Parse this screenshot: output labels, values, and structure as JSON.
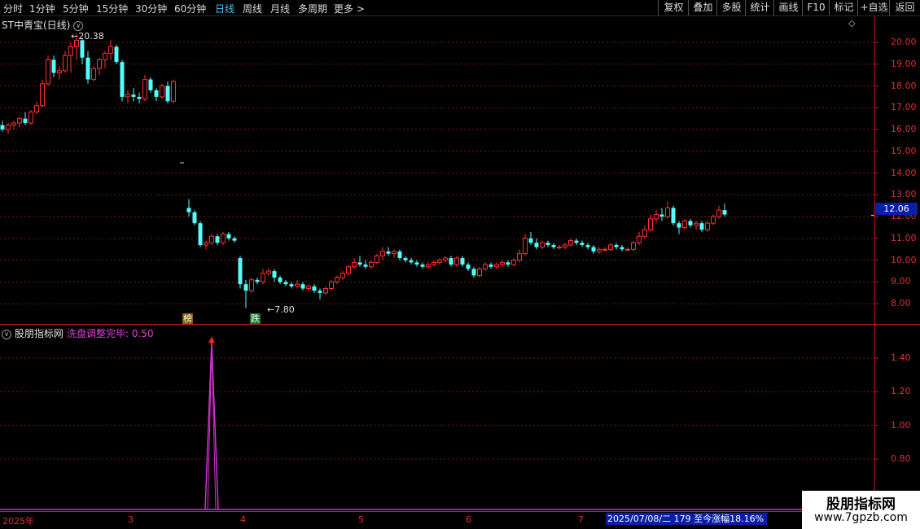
{
  "toolbar": {
    "periods": [
      "分时",
      "1分钟",
      "5分钟",
      "15分钟",
      "30分钟",
      "60分钟",
      "日线",
      "周线",
      "月线",
      "多周期",
      "更多"
    ],
    "active_period": "日线",
    "more_arrow": ">",
    "right_buttons": [
      "复权",
      "叠加",
      "多股",
      "统计",
      "画线",
      "F10",
      "标记",
      "+自选",
      "返回"
    ]
  },
  "chart_header": {
    "stock_name": "ST中青宝(日线)",
    "dropdown_icon": "∨",
    "settings_icon": "◇"
  },
  "annotations": {
    "high_label": "20.38",
    "low_label": "7.80",
    "marker_bang": "榜",
    "marker_die": "跌"
  },
  "current_price": "12.06",
  "indicator": {
    "name": "股朋指标网",
    "line_label": "洗盘调整完毕: 0.50"
  },
  "date_axis": [
    "2025年",
    "3",
    "4",
    "5",
    "6",
    "7"
  ],
  "status_text": "2025/07/08/二  179 至今涨幅18.16%",
  "watermark": {
    "title": "股朋指标网",
    "url": "www.7gpzb.com"
  },
  "colors": {
    "up": "#ff3232",
    "down": "#54fcfc",
    "axis": "#c02020",
    "indicator": "#d030d0",
    "accent": "#4fc3ff"
  },
  "chart_data": {
    "type": "candlestick",
    "price_axis_ticks": [
      "20.00",
      "19.00",
      "18.00",
      "17.00",
      "16.00",
      "15.00",
      "14.00",
      "13.00",
      "12.00",
      "11.00",
      "10.00",
      "9.00",
      "8.00"
    ],
    "indicator_axis_ticks": [
      "1.40",
      "1.20",
      "1.00",
      "0.80"
    ],
    "ylim": [
      7.3,
      21.0
    ],
    "indicator_ylim": [
      0.5,
      1.6
    ],
    "high": 20.38,
    "low": 7.8,
    "last": 12.06,
    "indicator_peak": 1.5,
    "ohlc": [
      [
        16.2,
        16.4,
        15.9,
        16.0
      ],
      [
        16.0,
        16.3,
        15.8,
        16.2
      ],
      [
        16.2,
        16.4,
        16.0,
        16.3
      ],
      [
        16.3,
        16.6,
        16.1,
        16.5
      ],
      [
        16.5,
        16.8,
        16.2,
        16.3
      ],
      [
        16.3,
        16.9,
        16.2,
        16.8
      ],
      [
        16.8,
        17.3,
        16.7,
        17.1
      ],
      [
        17.1,
        18.3,
        17.0,
        18.1
      ],
      [
        18.1,
        19.4,
        18.0,
        19.2
      ],
      [
        19.2,
        19.4,
        18.4,
        18.6
      ],
      [
        18.6,
        18.9,
        18.3,
        18.7
      ],
      [
        18.7,
        19.6,
        18.6,
        19.4
      ],
      [
        19.4,
        20.0,
        18.6,
        19.8
      ],
      [
        19.8,
        20.38,
        19.2,
        20.1
      ],
      [
        20.1,
        20.2,
        19.0,
        19.3
      ],
      [
        19.3,
        19.6,
        18.1,
        18.3
      ],
      [
        18.3,
        18.9,
        18.2,
        18.8
      ],
      [
        18.8,
        19.3,
        18.5,
        19.2
      ],
      [
        19.2,
        19.6,
        18.8,
        19.5
      ],
      [
        19.5,
        20.1,
        19.2,
        19.8
      ],
      [
        19.8,
        19.9,
        19.0,
        19.1
      ],
      [
        19.1,
        19.2,
        17.3,
        17.5
      ],
      [
        17.5,
        17.8,
        17.2,
        17.6
      ],
      [
        17.6,
        17.9,
        17.3,
        17.5
      ],
      [
        17.5,
        17.7,
        17.2,
        17.4
      ],
      [
        17.4,
        18.5,
        17.3,
        18.3
      ],
      [
        18.3,
        18.4,
        17.7,
        17.8
      ],
      [
        17.8,
        17.9,
        17.3,
        17.5
      ],
      [
        17.5,
        18.1,
        17.4,
        18.0
      ],
      [
        18.0,
        18.2,
        17.2,
        17.3
      ],
      [
        17.3,
        18.3,
        17.2,
        18.2
      ],
      [
        12.4,
        12.8,
        12.0,
        12.2
      ],
      [
        12.2,
        12.3,
        11.6,
        11.7
      ],
      [
        11.7,
        11.8,
        10.6,
        10.7
      ],
      [
        10.7,
        10.9,
        10.5,
        10.8
      ],
      [
        10.8,
        11.2,
        10.7,
        11.1
      ],
      [
        11.1,
        11.2,
        10.7,
        10.8
      ],
      [
        10.8,
        11.3,
        10.7,
        11.2
      ],
      [
        11.2,
        11.3,
        10.9,
        11.0
      ],
      [
        11.0,
        11.1,
        10.8,
        10.9
      ],
      [
        10.1,
        10.2,
        8.7,
        8.9
      ],
      [
        8.9,
        9.1,
        7.8,
        8.6
      ],
      [
        8.6,
        9.2,
        8.5,
        9.1
      ],
      [
        9.1,
        9.2,
        8.9,
        9.0
      ],
      [
        9.0,
        9.6,
        8.9,
        9.4
      ],
      [
        9.4,
        9.6,
        9.3,
        9.5
      ],
      [
        9.5,
        9.6,
        9.0,
        9.2
      ],
      [
        9.2,
        9.3,
        8.9,
        9.0
      ],
      [
        9.0,
        9.1,
        8.8,
        8.9
      ],
      [
        8.9,
        9.0,
        8.7,
        8.8
      ],
      [
        8.8,
        9.1,
        8.7,
        8.9
      ],
      [
        8.9,
        9.0,
        8.6,
        8.7
      ],
      [
        8.7,
        8.9,
        8.6,
        8.8
      ],
      [
        8.8,
        8.9,
        8.5,
        8.6
      ],
      [
        8.6,
        8.7,
        8.2,
        8.5
      ],
      [
        8.5,
        8.8,
        8.4,
        8.7
      ],
      [
        8.7,
        9.1,
        8.6,
        9.0
      ],
      [
        9.0,
        9.3,
        8.9,
        9.2
      ],
      [
        9.2,
        9.5,
        9.1,
        9.4
      ],
      [
        9.4,
        9.8,
        9.3,
        9.7
      ],
      [
        9.7,
        10.1,
        9.6,
        9.9
      ],
      [
        9.9,
        10.2,
        9.7,
        9.8
      ],
      [
        9.8,
        10.0,
        9.6,
        9.7
      ],
      [
        9.7,
        10.0,
        9.6,
        9.9
      ],
      [
        9.9,
        10.3,
        9.8,
        10.2
      ],
      [
        10.2,
        10.6,
        10.0,
        10.4
      ],
      [
        10.4,
        10.6,
        10.2,
        10.3
      ],
      [
        10.3,
        10.5,
        10.1,
        10.4
      ],
      [
        10.4,
        10.5,
        10.0,
        10.1
      ],
      [
        10.1,
        10.2,
        9.9,
        10.0
      ],
      [
        10.0,
        10.1,
        9.8,
        9.9
      ],
      [
        9.9,
        10.0,
        9.7,
        9.8
      ],
      [
        9.8,
        9.9,
        9.6,
        9.7
      ],
      [
        9.7,
        9.9,
        9.6,
        9.8
      ],
      [
        9.8,
        10.0,
        9.7,
        9.9
      ],
      [
        9.9,
        10.1,
        9.8,
        10.0
      ],
      [
        10.0,
        10.2,
        9.9,
        10.1
      ],
      [
        10.1,
        10.2,
        9.7,
        9.8
      ],
      [
        9.8,
        10.2,
        9.7,
        10.1
      ],
      [
        10.1,
        10.2,
        9.7,
        9.8
      ],
      [
        9.8,
        9.9,
        9.5,
        9.6
      ],
      [
        9.6,
        9.7,
        9.2,
        9.3
      ],
      [
        9.3,
        9.7,
        9.2,
        9.6
      ],
      [
        9.6,
        9.9,
        9.5,
        9.8
      ],
      [
        9.8,
        9.9,
        9.6,
        9.7
      ],
      [
        9.7,
        9.9,
        9.6,
        9.8
      ],
      [
        9.8,
        10.0,
        9.7,
        9.9
      ],
      [
        9.9,
        10.0,
        9.7,
        9.8
      ],
      [
        9.8,
        10.1,
        9.7,
        10.0
      ],
      [
        10.0,
        10.5,
        9.9,
        10.3
      ],
      [
        10.3,
        11.2,
        10.2,
        11.0
      ],
      [
        11.0,
        11.3,
        10.7,
        10.8
      ],
      [
        10.8,
        11.0,
        10.5,
        10.6
      ],
      [
        10.6,
        10.9,
        10.5,
        10.8
      ],
      [
        10.8,
        10.9,
        10.6,
        10.7
      ],
      [
        10.7,
        10.8,
        10.5,
        10.6
      ],
      [
        10.6,
        10.7,
        10.5,
        10.6
      ],
      [
        10.6,
        10.8,
        10.5,
        10.7
      ],
      [
        10.7,
        11.0,
        10.6,
        10.9
      ],
      [
        10.9,
        11.0,
        10.7,
        10.8
      ],
      [
        10.8,
        10.9,
        10.6,
        10.7
      ],
      [
        10.7,
        10.8,
        10.5,
        10.6
      ],
      [
        10.6,
        10.7,
        10.3,
        10.4
      ],
      [
        10.4,
        10.6,
        10.3,
        10.5
      ],
      [
        10.5,
        10.6,
        10.4,
        10.5
      ],
      [
        10.5,
        10.8,
        10.4,
        10.7
      ],
      [
        10.7,
        10.8,
        10.5,
        10.6
      ],
      [
        10.6,
        10.7,
        10.4,
        10.5
      ],
      [
        10.5,
        10.6,
        10.4,
        10.5
      ],
      [
        10.5,
        10.9,
        10.4,
        10.8
      ],
      [
        10.8,
        11.3,
        10.7,
        11.1
      ],
      [
        11.1,
        11.6,
        11.0,
        11.4
      ],
      [
        11.4,
        12.1,
        11.3,
        11.9
      ],
      [
        11.9,
        12.3,
        11.7,
        12.1
      ],
      [
        12.1,
        12.4,
        11.8,
        12.0
      ],
      [
        12.0,
        12.7,
        11.9,
        12.4
      ],
      [
        12.4,
        12.5,
        11.6,
        11.7
      ],
      [
        11.7,
        11.8,
        11.2,
        11.5
      ],
      [
        11.5,
        11.9,
        11.4,
        11.8
      ],
      [
        11.8,
        11.9,
        11.5,
        11.6
      ],
      [
        11.6,
        11.8,
        11.4,
        11.7
      ],
      [
        11.7,
        11.8,
        11.3,
        11.4
      ],
      [
        11.4,
        11.8,
        11.3,
        11.7
      ],
      [
        11.7,
        12.1,
        11.6,
        12.0
      ],
      [
        12.0,
        12.5,
        11.9,
        12.3
      ],
      [
        12.3,
        12.6,
        12.0,
        12.1
      ]
    ]
  }
}
